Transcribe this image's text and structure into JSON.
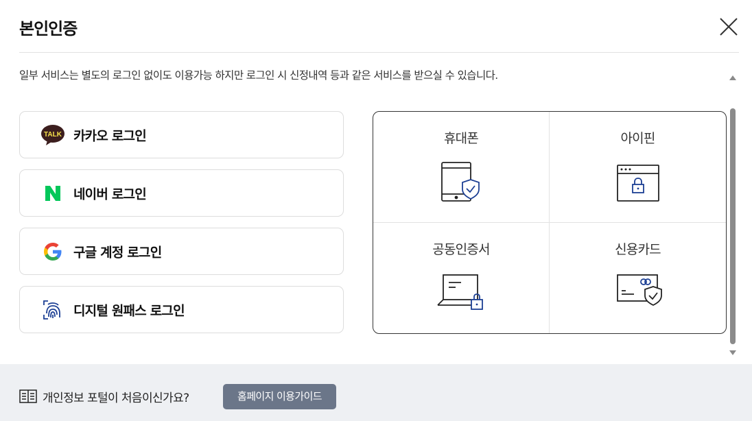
{
  "header": {
    "title": "본인인증",
    "close_icon": "close-icon"
  },
  "description": "일부 서비스는 별도의 로그인 없이도 이용가능 하지만 로그인 시 신정내역 등과 같은 서비스를 받으실 수 있습니다.",
  "social_logins": [
    {
      "label": "카카오 로그인",
      "icon": "kakao-talk-icon",
      "icon_text": "TALK",
      "color": "#3c1e1e"
    },
    {
      "label": "네이버 로그인",
      "icon": "naver-icon",
      "icon_text": "N",
      "color": "#03c75a"
    },
    {
      "label": "구글 계정 로그인",
      "icon": "google-icon"
    },
    {
      "label": "디지털 원패스 로그인",
      "icon": "fingerprint-icon",
      "color": "#1c3f94"
    }
  ],
  "auth_methods": [
    {
      "label": "휴대폰",
      "icon": "mobile-shield-icon"
    },
    {
      "label": "아이핀",
      "icon": "browser-lock-icon"
    },
    {
      "label": "공동인증서",
      "icon": "laptop-lock-icon"
    },
    {
      "label": "신용카드",
      "icon": "card-shield-icon"
    }
  ],
  "footer": {
    "prompt": "개인정보 포털이 처음이신가요?",
    "guide_button": "홈페이지 이용가이드",
    "book_icon": "book-icon",
    "button_color": "#6b7689"
  },
  "colors": {
    "accent_blue": "#1c3f94",
    "border": "#dcdcdc",
    "footer_bg": "#eef0f3"
  }
}
